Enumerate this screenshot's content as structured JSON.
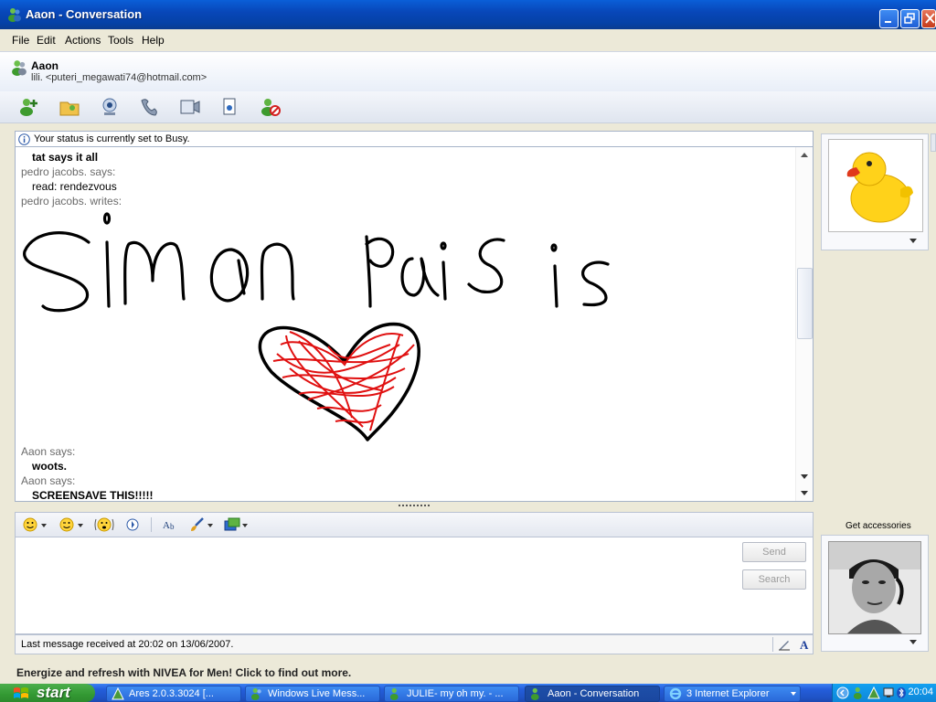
{
  "window": {
    "title": "Aaon - Conversation"
  },
  "menu": [
    "File",
    "Edit",
    "Actions",
    "Tools",
    "Help"
  ],
  "contact": {
    "name": "Aaon",
    "subline": "lili. <puteri_megawati74@hotmail.com>"
  },
  "status_notice": "Your status is currently set to Busy.",
  "chat": {
    "lines": [
      {
        "kind": "msg",
        "text": "tat says it all",
        "bold": true
      },
      {
        "kind": "who",
        "text": "pedro jacobs. says:"
      },
      {
        "kind": "msg",
        "text": "read: rendezvous",
        "bold": false
      },
      {
        "kind": "who",
        "text": "pedro jacobs. writes:"
      },
      {
        "kind": "who",
        "text": "Aaon says:"
      },
      {
        "kind": "msg",
        "text": "woots.",
        "bold": true
      },
      {
        "kind": "who",
        "text": "Aaon says:"
      },
      {
        "kind": "msg",
        "text": "SCREENSAVE THIS!!!!!",
        "bold": true
      }
    ],
    "ink_text": "simon pais is"
  },
  "buttons": {
    "send": "Send",
    "search": "Search"
  },
  "last_message": "Last message received at 20:02 on 13/06/2007.",
  "ad_text": "Energize and refresh with NIVEA for Men! Click to find out more.",
  "accessories_label": "Get accessories",
  "taskbar": {
    "start": "start",
    "tasks": [
      {
        "label": "Ares 2.0.3.3024  [..."
      },
      {
        "label": "Windows Live Mess..."
      },
      {
        "label": "JULIE- my oh my. - ..."
      },
      {
        "label": "Aaon - Conversation"
      },
      {
        "label": "3 Internet Explorer"
      }
    ],
    "clock": "20:04"
  },
  "colors": {
    "titlebar": "#0847b9",
    "taskbar": "#245edb",
    "start": "#339933",
    "heart": "#e01010"
  }
}
